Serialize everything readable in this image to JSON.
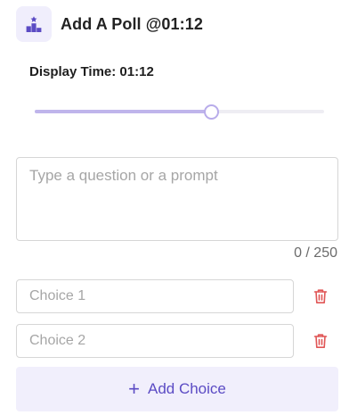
{
  "header": {
    "title": "Add A Poll @01:12",
    "icon": "poll-podium-icon"
  },
  "display_time": {
    "label": "Display Time: 01:12",
    "slider_fraction": 0.61
  },
  "question": {
    "placeholder": "Type a question or a prompt",
    "value": "",
    "char_count": "0 / 250"
  },
  "choices": [
    {
      "placeholder": "Choice 1",
      "value": ""
    },
    {
      "placeholder": "Choice 2",
      "value": ""
    }
  ],
  "add_choice": {
    "icon": "plus",
    "label": "Add Choice"
  },
  "colors": {
    "accent": "#5b4bc4",
    "accent_light": "#f1effc",
    "delete": "#e05555"
  }
}
